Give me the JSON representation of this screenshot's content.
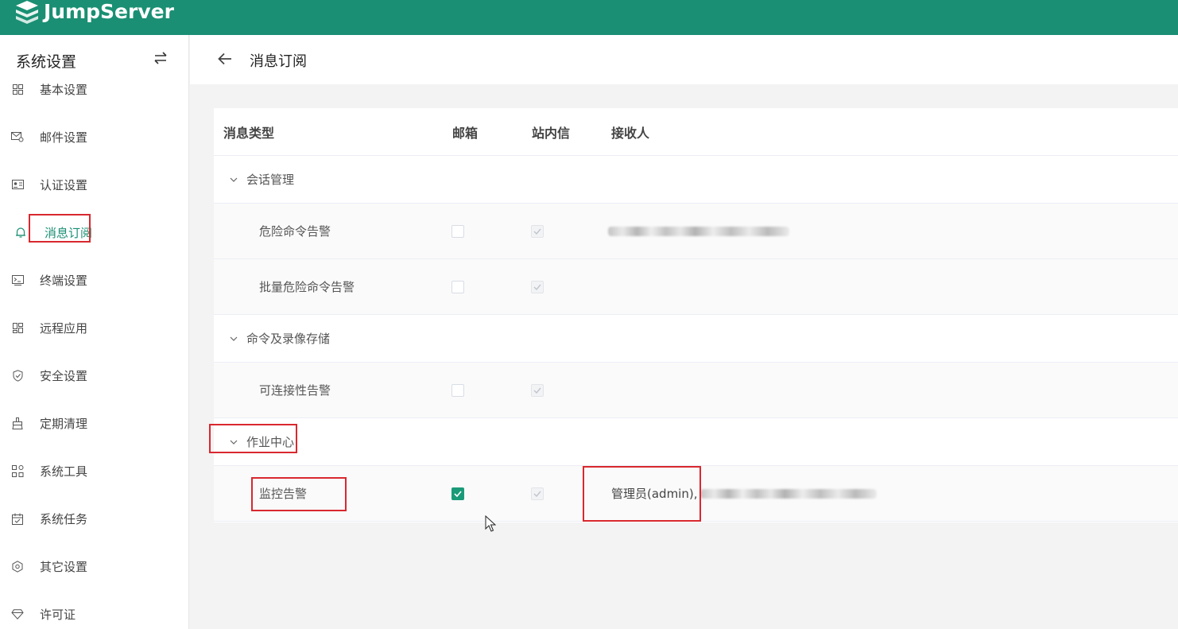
{
  "app": {
    "name": "JumpServer"
  },
  "sidebar": {
    "title": "系统设置",
    "items": [
      {
        "label": "基本设置",
        "icon": "grid-icon"
      },
      {
        "label": "邮件设置",
        "icon": "mail-settings-icon"
      },
      {
        "label": "认证设置",
        "icon": "id-card-icon"
      },
      {
        "label": "消息订阅",
        "icon": "bell-icon",
        "active": true
      },
      {
        "label": "终端设置",
        "icon": "terminal-icon"
      },
      {
        "label": "远程应用",
        "icon": "apps-icon"
      },
      {
        "label": "安全设置",
        "icon": "shield-icon"
      },
      {
        "label": "定期清理",
        "icon": "broom-icon"
      },
      {
        "label": "系统工具",
        "icon": "tools-icon"
      },
      {
        "label": "系统任务",
        "icon": "calendar-icon"
      },
      {
        "label": "其它设置",
        "icon": "hex-settings-icon"
      },
      {
        "label": "许可证",
        "icon": "diamond-icon"
      }
    ]
  },
  "page": {
    "title": "消息订阅"
  },
  "table": {
    "headers": {
      "type": "消息类型",
      "email": "邮箱",
      "site_msg": "站内信",
      "receivers": "接收人"
    },
    "groups": [
      {
        "label": "会话管理",
        "items": [
          {
            "label": "危险命令告警",
            "email": false,
            "site_msg": true,
            "receivers": ""
          },
          {
            "label": "批量危险命令告警",
            "email": false,
            "site_msg": true,
            "receivers": ""
          }
        ]
      },
      {
        "label": "命令及录像存储",
        "items": [
          {
            "label": "可连接性告警",
            "email": false,
            "site_msg": true,
            "receivers": ""
          }
        ]
      },
      {
        "label": "作业中心",
        "items": [
          {
            "label": "监控告警",
            "email": true,
            "site_msg": true,
            "receivers": "管理员(admin),"
          }
        ]
      }
    ]
  },
  "colors": {
    "brand": "#1a8f73",
    "highlight": "#d9282f",
    "checked": "#1a9a78"
  }
}
